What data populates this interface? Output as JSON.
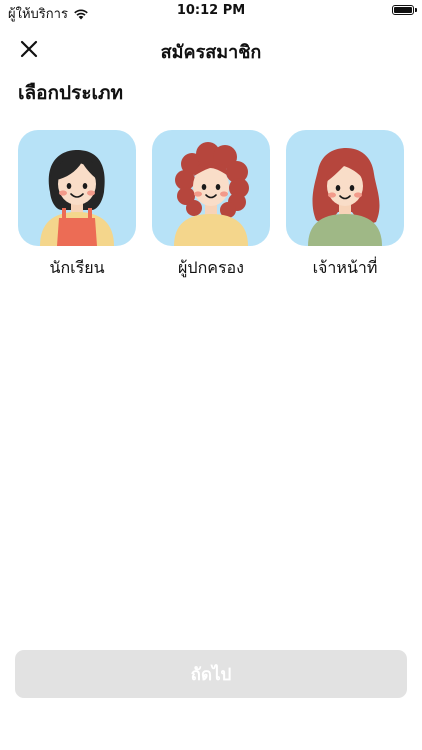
{
  "status_bar": {
    "carrier": "ผู้ให้บริการ",
    "time": "10:12 PM"
  },
  "nav": {
    "title": "สมัครสมาชิก",
    "close_icon": "close-icon"
  },
  "section": {
    "title": "เลือกประเภท"
  },
  "roles": [
    {
      "label": "นักเรียน",
      "avatar": "student-avatar"
    },
    {
      "label": "ผู้ปกครอง",
      "avatar": "parent-avatar"
    },
    {
      "label": "เจ้าหน้าที่",
      "avatar": "staff-avatar"
    }
  ],
  "footer": {
    "next_label": "ถัดไป"
  },
  "colors": {
    "avatar_background": "#b7e2f7",
    "button_disabled": "#e2e2e2"
  }
}
